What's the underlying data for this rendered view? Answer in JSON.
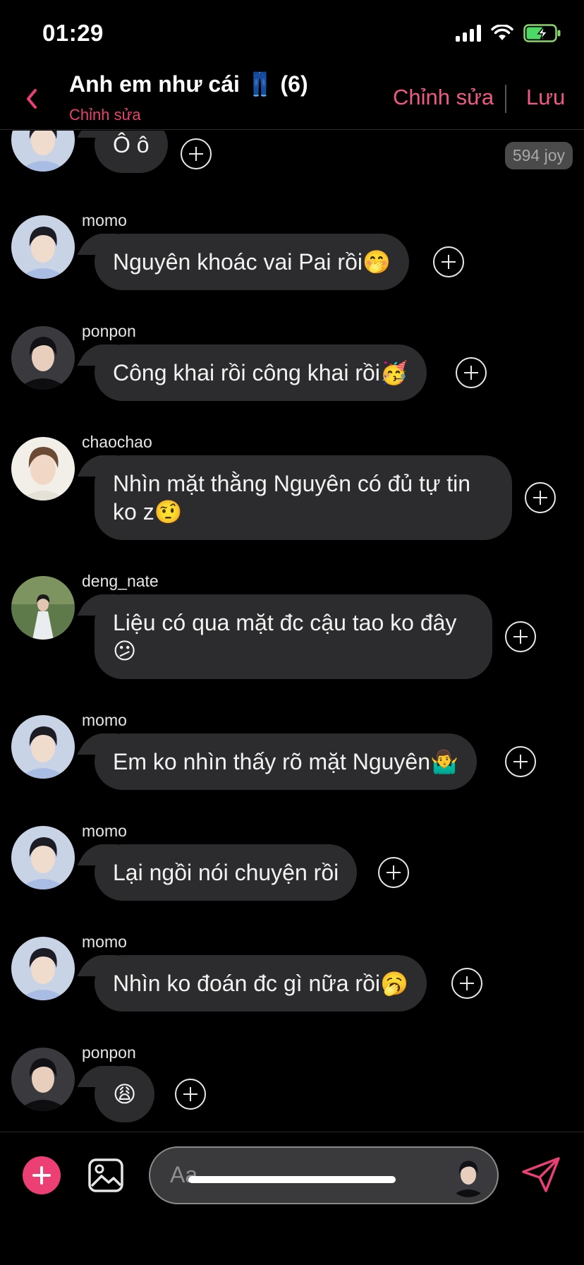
{
  "status_bar": {
    "time": "01:29"
  },
  "header": {
    "title": "Anh em như cái 👖 (6)",
    "subtitle": "Chỉnh sửa",
    "edit_label": "Chỉnh sửa",
    "save_label": "Lưu"
  },
  "badge": {
    "text": "594 joy"
  },
  "messages": [
    {
      "username": "",
      "text": "Ô ô",
      "emoji": "",
      "avatar": "momo"
    },
    {
      "username": "momo",
      "text": "Nguyên khoác vai Pai rồi",
      "emoji": "🤭",
      "avatar": "momo"
    },
    {
      "username": "ponpon",
      "text": "Công khai rồi công khai rồi",
      "emoji": "🥳",
      "avatar": "ponpon"
    },
    {
      "username": "chaochao",
      "text": "Nhìn mặt thằng Nguyên có đủ tự tin ko z",
      "emoji": "🤨",
      "avatar": "chaochao"
    },
    {
      "username": "deng_nate",
      "text": "Liệu có qua mặt đc cậu tao ko đây",
      "emoji": "😕",
      "avatar": "deng"
    },
    {
      "username": "momo",
      "text": "Em ko nhìn thấy rõ mặt Nguyên",
      "emoji": "🤷‍♂️",
      "avatar": "momo"
    },
    {
      "username": "momo",
      "text": "Lại ngồi nói chuyện rồi",
      "emoji": "",
      "avatar": "momo"
    },
    {
      "username": "momo",
      "text": "Nhìn ko đoán đc gì nữa rồi",
      "emoji": "🥱",
      "avatar": "momo"
    },
    {
      "username": "ponpon",
      "text": "",
      "emoji": "😩",
      "avatar": "ponpon"
    }
  ],
  "composer": {
    "placeholder": "Aa"
  },
  "colors": {
    "accent": "#ec4074",
    "bubble": "#2c2c2e",
    "background": "#000000"
  }
}
